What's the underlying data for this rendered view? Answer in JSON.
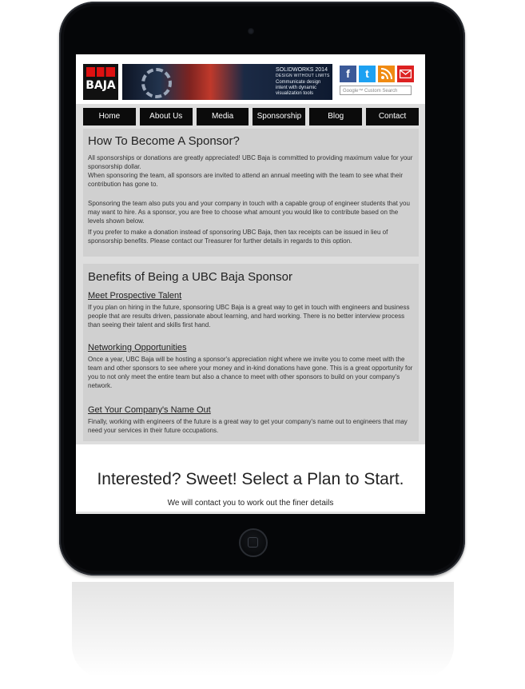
{
  "logo": {
    "text": "BAJA"
  },
  "banner": {
    "line1": "SOLIDWORKS 2014",
    "line2": "DESIGN WITHOUT LIMITS",
    "line3": "Communicate design intent with dynamic visualization tools"
  },
  "social": {
    "facebook": "f",
    "twitter": "t"
  },
  "search": {
    "placeholder": "Google™ Custom Search"
  },
  "nav": [
    "Home",
    "About Us",
    "Media",
    "Sponsorship",
    "Blog",
    "Contact"
  ],
  "section1": {
    "title": "How To Become A Sponsor?",
    "p1": "All sponsorships or donations are greatly appreciated! UBC Baja is committed to providing maximum value for your sponsorship dollar.",
    "p2": "When sponsoring the team, all sponsors are invited to attend an annual meeting with the team to see what their contribution has gone to.",
    "p3": "Sponsoring the team also puts you and your company in touch with a capable group of engineer students that you may want to hire. As a sponsor, you are free to choose what amount you would like to contribute based on the levels shown below.",
    "p4": "If you prefer to make a donation instead of sponsoring UBC Baja, then tax receipts can be issued in lieu of sponsorship benefits. Please contact our Treasurer for further details in regards to this option."
  },
  "section2": {
    "title": "Benefits of Being a UBC Baja Sponsor",
    "sub1": "Meet Prospective Talent",
    "t1": "If you plan on hiring in the future, sponsoring UBC Baja is a great way to get in touch with engineers and business people that are results driven, passionate about learning, and hard working. There is no better interview process than seeing their talent and skills first hand.",
    "sub2": "Networking Opportunities",
    "t2": "Once a year, UBC Baja will be hosting a sponsor's appreciation night where we invite you to come meet with the team and other sponsors to see where your money and in-kind donations have gone. This is a great opportunity for you to not only meet the entire team but also a chance to meet with other sponsors to build on your company's network.",
    "sub3": "Get Your Company's Name Out",
    "t3": "Finally, working with engineers of the future is a great way to get your company's name out to engineers that may need your services in their future occupations."
  },
  "cta": {
    "title": "Interested? Sweet! Select a Plan to Start.",
    "subtitle": "We will contact you to work out the finer details"
  }
}
